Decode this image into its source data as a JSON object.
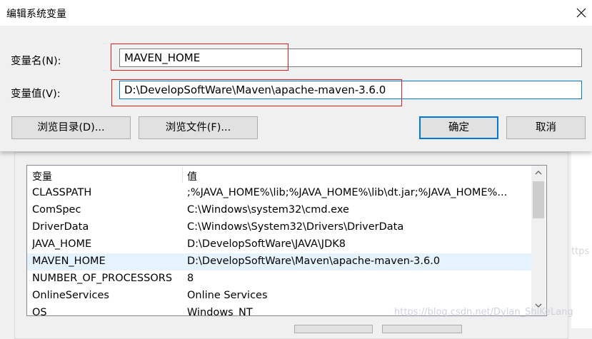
{
  "dialog": {
    "title": "编辑系统变量",
    "name_label": "变量名(N):",
    "value_label": "变量值(V):",
    "name_value": "MAVEN_HOME",
    "value_value": "D:\\DevelopSoftWare\\Maven\\apache-maven-3.6.0",
    "browse_dir_label": "浏览目录(D)...",
    "browse_file_label": "浏览文件(F)...",
    "ok_label": "确定",
    "cancel_label": "取消"
  },
  "variables": {
    "headers": [
      "变量",
      "值"
    ],
    "rows": [
      {
        "name": "CLASSPATH",
        "value": ";%JAVA_HOME%\\lib;%JAVA_HOME%\\lib\\dt.jar;%JAVA_HOME%..."
      },
      {
        "name": "ComSpec",
        "value": "C:\\Windows\\system32\\cmd.exe"
      },
      {
        "name": "DriverData",
        "value": "C:\\Windows\\System32\\Drivers\\DriverData"
      },
      {
        "name": "JAVA_HOME",
        "value": "D:\\DevelopSoftWare\\JAVA\\JDK8"
      },
      {
        "name": "MAVEN_HOME",
        "value": "D:\\DevelopSoftWare\\Maven\\apache-maven-3.6.0",
        "selected": true
      },
      {
        "name": "NUMBER_OF_PROCESSORS",
        "value": "8"
      },
      {
        "name": "OnlineServices",
        "value": "Online Services"
      },
      {
        "name": "OS",
        "value": "Windows_NT"
      }
    ]
  },
  "watermark": "https://blog.csdn.net/Dylan_ShiKeLang",
  "side_watermark": "ttps",
  "icons": {
    "close": "close-icon",
    "scroll_up": "chevron-up-icon",
    "scroll_down": "chevron-down-icon"
  },
  "colors": {
    "accent": "#0078d7",
    "highlight_box": "#e2201b",
    "selected_row": "#e5f3ff"
  }
}
